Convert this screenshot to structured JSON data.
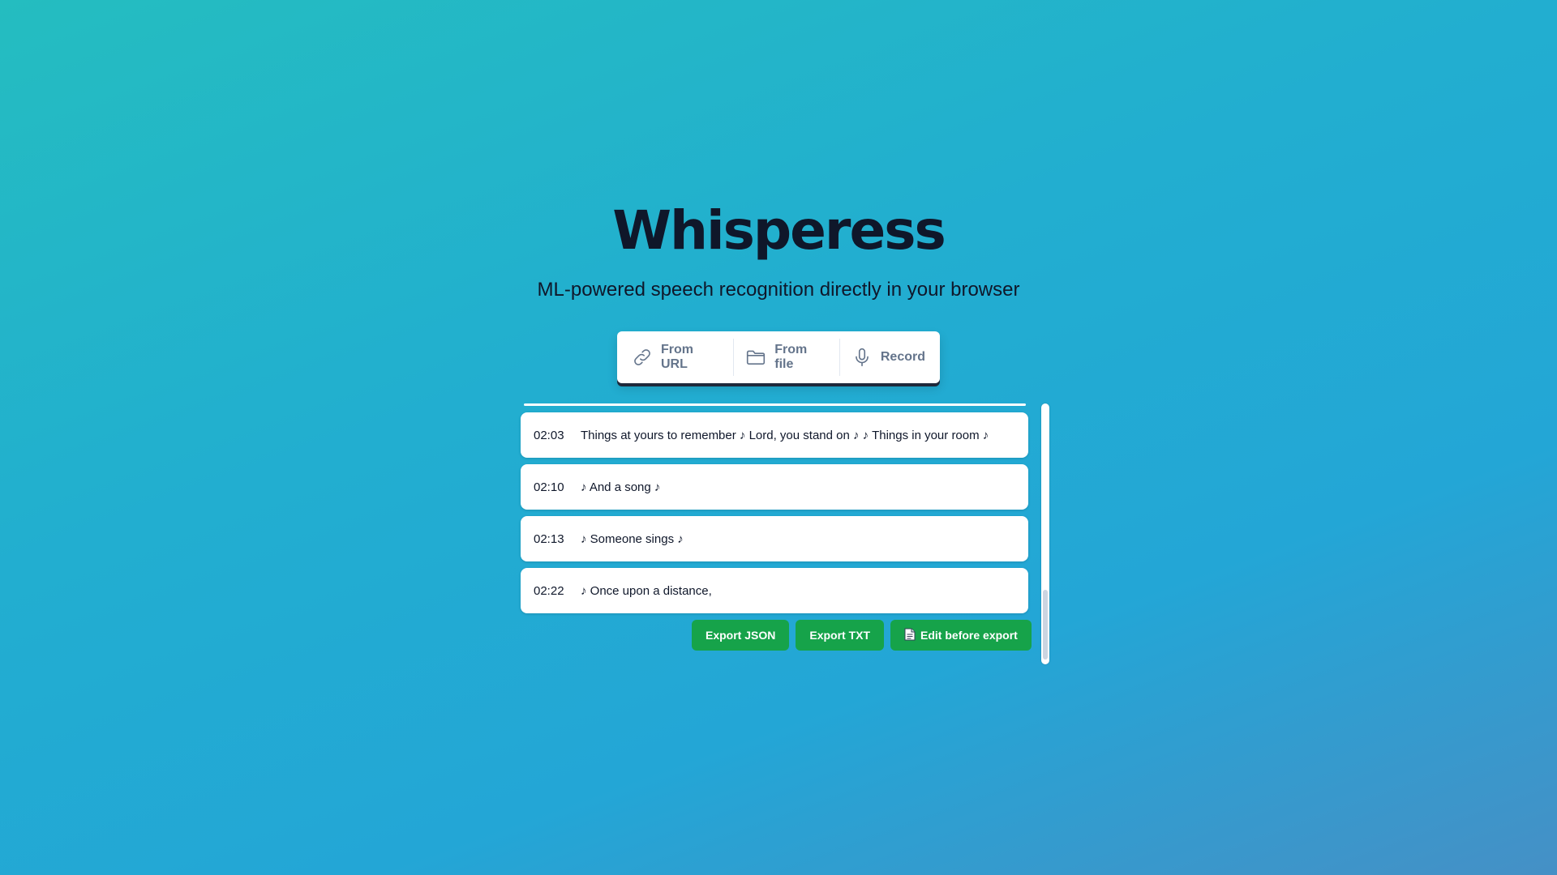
{
  "header": {
    "title": "Whisperess",
    "subtitle": "ML-powered speech recognition directly in your browser"
  },
  "sources": [
    {
      "label": "From URL",
      "icon": "link-icon"
    },
    {
      "label": "From file",
      "icon": "folder-icon"
    },
    {
      "label": "Record",
      "icon": "microphone-icon"
    }
  ],
  "transcript": {
    "rows": [
      {
        "time": "02:03",
        "text": "Things at yours to remember ♪ Lord, you stand on ♪ ♪ Things in your room ♪"
      },
      {
        "time": "02:10",
        "text": "♪ And a song ♪"
      },
      {
        "time": "02:13",
        "text": "♪ Someone sings ♪"
      },
      {
        "time": "02:22",
        "text": "♪ Once upon a distance,"
      }
    ]
  },
  "export": {
    "json_label": "Export JSON",
    "txt_label": "Export TXT",
    "edit_label": "Edit before export",
    "edit_icon": "document-icon"
  },
  "colors": {
    "accent": "#16a34a",
    "title": "#0f172a",
    "source_text": "#64748b"
  }
}
